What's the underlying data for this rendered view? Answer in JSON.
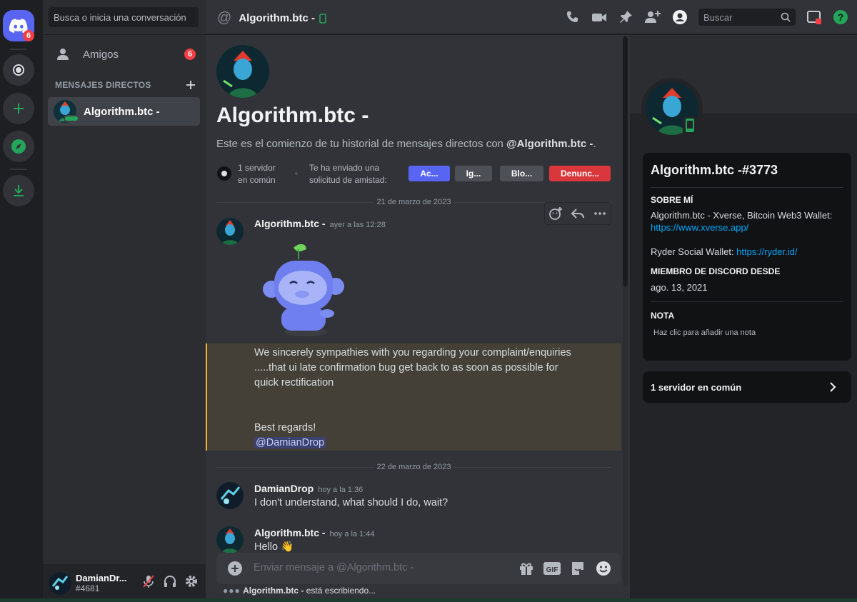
{
  "rail": {
    "home_badge": "6"
  },
  "dm_sidebar": {
    "search_placeholder": "Busca o inicia una conversación",
    "friends_label": "Amigos",
    "friends_badge": "6",
    "section_title": "MENSAJES DIRECTOS",
    "dm_items": [
      {
        "name": "Algorithm.btc -"
      }
    ]
  },
  "user": {
    "name": "DamianDr...",
    "tag": "#4681"
  },
  "header": {
    "title": "Algorithm.btc -",
    "search_placeholder": "Buscar"
  },
  "chat": {
    "title": "Algorithm.btc -",
    "intro_prefix": "Este es el comienzo de tu historial de mensajes directos con ",
    "intro_user": "@Algorithm.btc -",
    "intro_suffix": ".",
    "mutual_servers": [
      "1 servidor",
      "en común"
    ],
    "friend_request": [
      "Te ha enviado una",
      "solicitud de amistad:"
    ],
    "buttons": {
      "accept": "Ac...",
      "ignore": "Ig...",
      "block": "Blo...",
      "report": "Denunc..."
    },
    "date_1": "21 de marzo de 2023",
    "date_2": "22 de marzo de 2023",
    "messages": [
      {
        "author": "Algorithm.btc -",
        "time": "ayer a las 12:28"
      },
      {
        "author": "DamianDrop",
        "time": "hoy a la 1:36",
        "text": "I don't understand, what should I do, wait?"
      },
      {
        "author": "Algorithm.btc -",
        "time": "hoy a la 1:44",
        "text": "Hello 👋"
      }
    ],
    "quote_lines": [
      "We sincerely sympathies with you regarding your complaint/enquiries",
      ".....that ui late confirmation bug get back to as soon as possible for",
      "quick rectification"
    ],
    "quote_closing": "Best regards!",
    "quote_mention": "@DamianDrop",
    "composer_placeholder": "Enviar mensaje a @Algorithm.btc -",
    "typing_user": "Algorithm.btc -",
    "typing_suffix": " está escribiendo..."
  },
  "profile": {
    "username": "Algorithm.btc -#3773",
    "about_title": "SOBRE MÍ",
    "about_line1": "Algorithm.btc - Xverse, Bitcoin Web3 Wallet:",
    "about_link1": "https://www.xverse.app/",
    "about_line2": "Ryder Social Wallet: ",
    "about_link2": "https://ryder.id/",
    "member_title": "MIEMBRO DE DISCORD DESDE",
    "member_since": "ago. 13, 2021",
    "note_title": "NOTA",
    "note_placeholder": "Haz clic para añadir una nota",
    "mutual_label": "1 servidor en común"
  },
  "colors": {
    "brand": "#5865f2",
    "danger": "#da373c",
    "link": "#00a8fc",
    "online": "#23a55a",
    "highlight_bar": "#f0b232"
  }
}
